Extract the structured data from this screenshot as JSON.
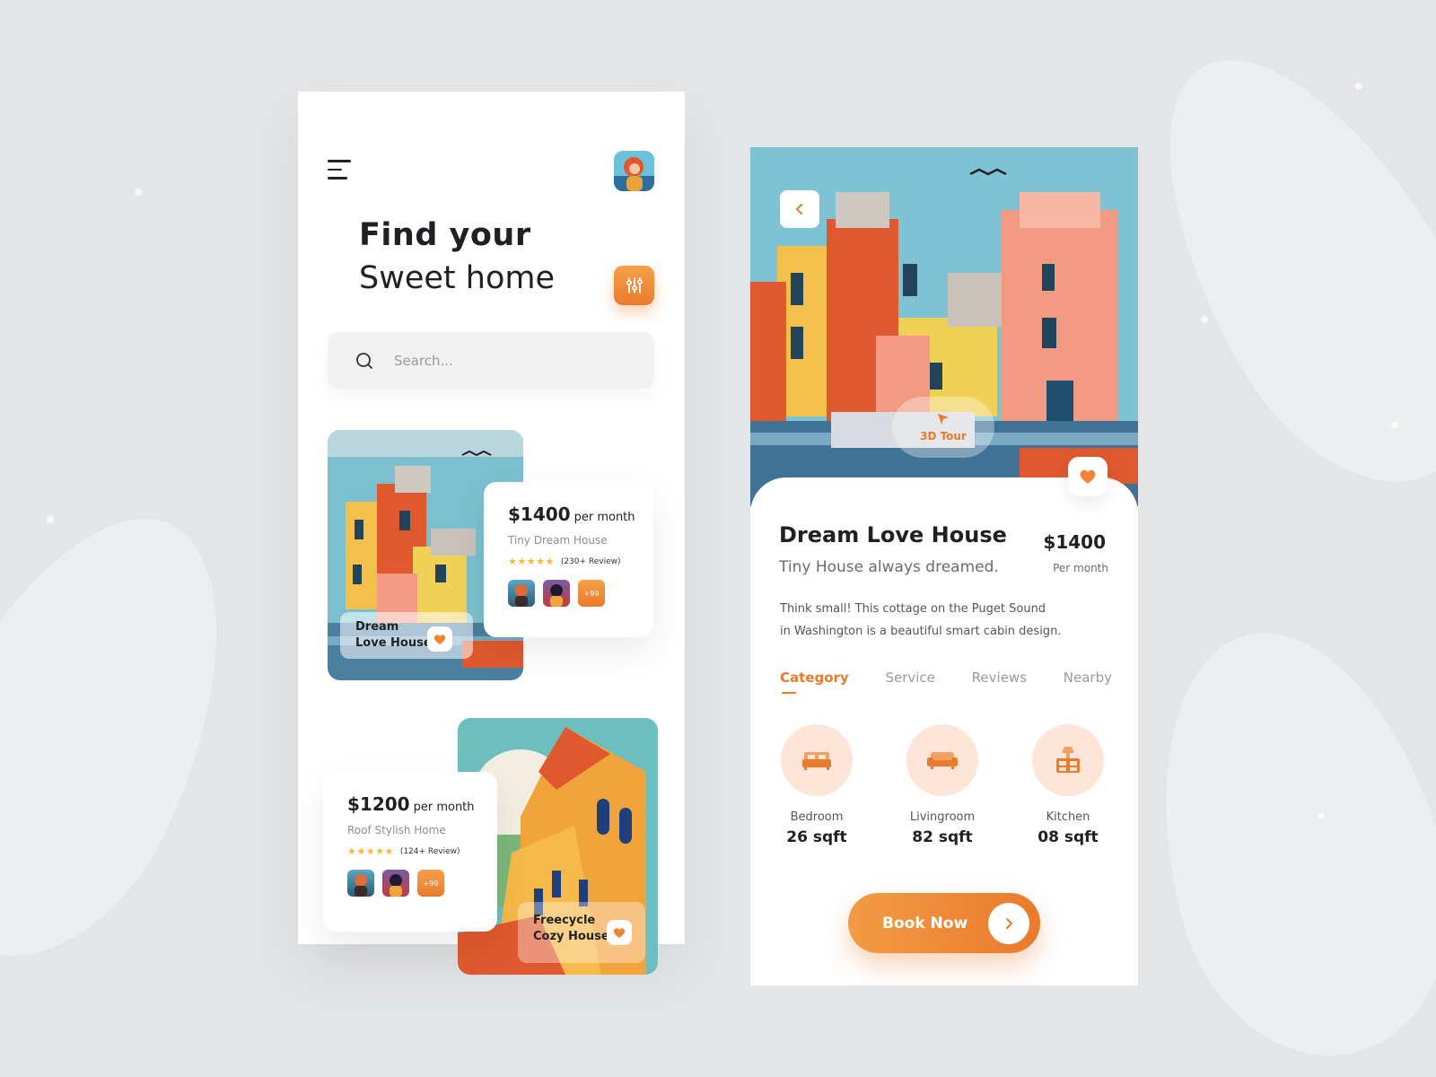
{
  "colors": {
    "accent": "#ea7a2c",
    "accent_light": "#fde6d7",
    "background": "#e4e5e7"
  },
  "home": {
    "title_line1": "Find your",
    "title_line2": "Sweet home",
    "search_placeholder": "Search...",
    "listings": [
      {
        "price": "$1400",
        "period": "per month",
        "name": "Tiny Dream House",
        "rating": 5,
        "reviews": "(230+ Review)",
        "more": "+99",
        "label_line1": "Dream",
        "label_line2": "Love House"
      },
      {
        "price": "$1200",
        "period": "per month",
        "name": "Roof Stylish Home",
        "rating": 5,
        "reviews": "(124+ Review)",
        "more": "+99",
        "label_line1": "Freecycle",
        "label_line2": "Cozy House"
      }
    ]
  },
  "detail": {
    "tour_label": "3D Tour",
    "title": "Dream Love House",
    "subtitle": "Tiny House always dreamed.",
    "price": "$1400",
    "price_period": "Per month",
    "description_line1": "Think small! This cottage on the Puget Sound",
    "description_line2": "in Washington is a beautiful smart cabin design.",
    "tabs": [
      "Category",
      "Service",
      "Reviews",
      "Nearby"
    ],
    "active_tab": "Category",
    "categories": [
      {
        "label": "Bedroom",
        "value": "26 sqft",
        "icon": "bed-icon"
      },
      {
        "label": "Livingroom",
        "value": "82 sqft",
        "icon": "sofa-icon"
      },
      {
        "label": "Kitchen",
        "value": "08 sqft",
        "icon": "kitchen-icon"
      }
    ],
    "book_label": "Book Now"
  }
}
